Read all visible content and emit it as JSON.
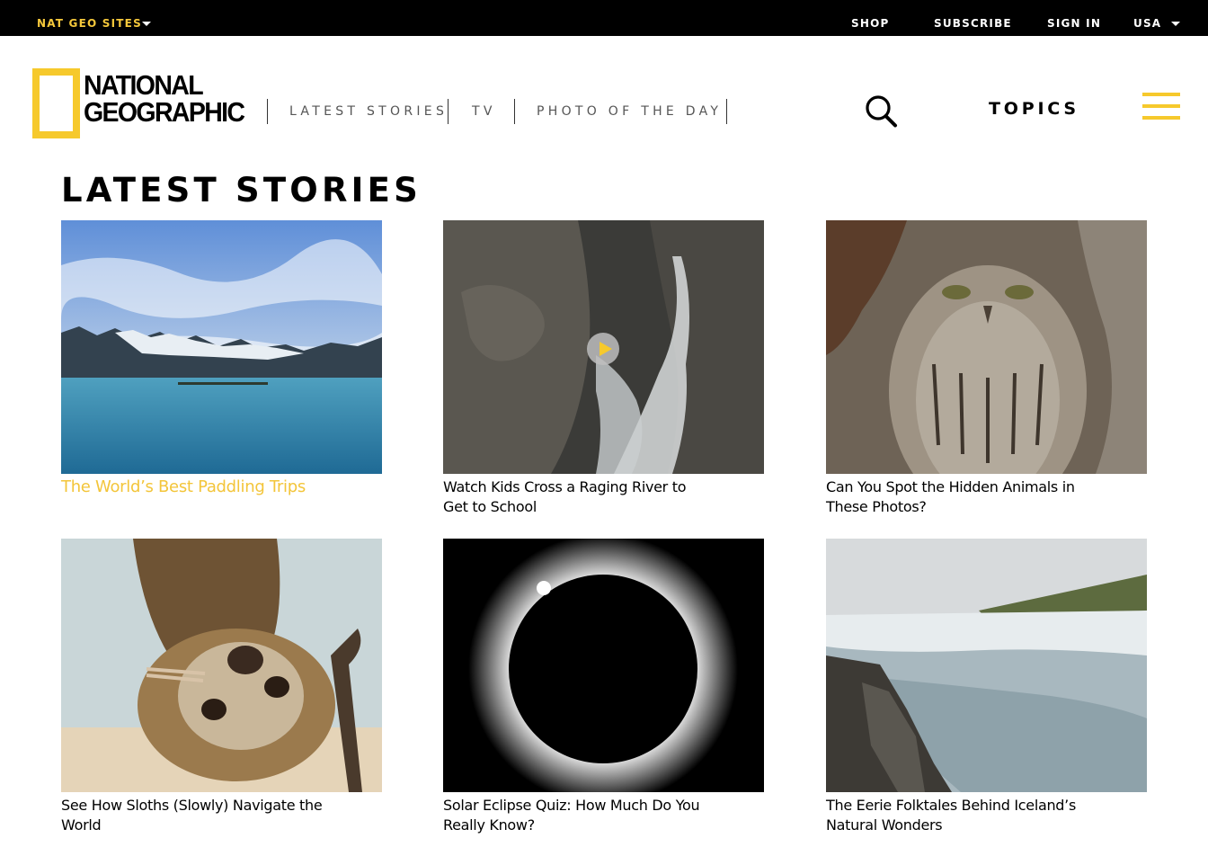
{
  "topbar": {
    "sites_label": "NAT GEO SITES",
    "shop": "SHOP",
    "subscribe": "SUBSCRIBE",
    "sign_in": "SIGN IN",
    "region": "USA"
  },
  "header": {
    "logo_line1": "NATIONAL",
    "logo_line2": "GEOGRAPHIC",
    "nav": [
      "LATEST STORIES",
      "TV",
      "PHOTO OF THE DAY"
    ],
    "topics": "TOPICS",
    "brand_yellow": "#f6c92c"
  },
  "main": {
    "section_title": "LATEST STORIES",
    "cards": [
      {
        "title": "The World’s Best Paddling Trips",
        "icon": "landscape-lake"
      },
      {
        "title": "Watch Kids Cross a Raging River to Get to School",
        "icon": "river-canyon",
        "has_video": true
      },
      {
        "title": "Can You Spot the Hidden Animals in These Photos?",
        "icon": "owl-bark"
      },
      {
        "title": "See How Sloths (Slowly) Navigate the World",
        "icon": "sloth"
      },
      {
        "title": "Solar Eclipse Quiz: How Much Do You Really Know?",
        "icon": "eclipse"
      },
      {
        "title": "The Eerie Folktales Behind Iceland’s Natural Wonders",
        "icon": "waterfall"
      }
    ]
  }
}
